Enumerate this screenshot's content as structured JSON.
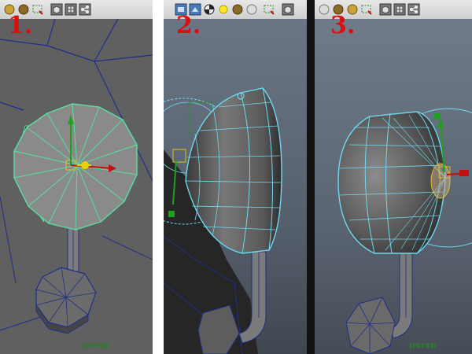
{
  "panels": [
    {
      "step": "1.",
      "camera_label": "persp"
    },
    {
      "step": "2.",
      "camera_label": ""
    },
    {
      "step": "3.",
      "camera_label": "persp"
    }
  ],
  "toolbar_icons": [
    "sphere-icon",
    "lasso-select-icon",
    "cube-icon",
    "grid-icon",
    "share-icon",
    "camera-icon",
    "light-icon",
    "checker-icon"
  ],
  "colors": {
    "viewport_gray": "#606060",
    "viewport_dark": "#2e2e2e",
    "wire_green": "#59e0a0",
    "wire_cyan": "#6fd8f0",
    "label_red": "#d81010",
    "persp_green": "#2f7a2f"
  }
}
